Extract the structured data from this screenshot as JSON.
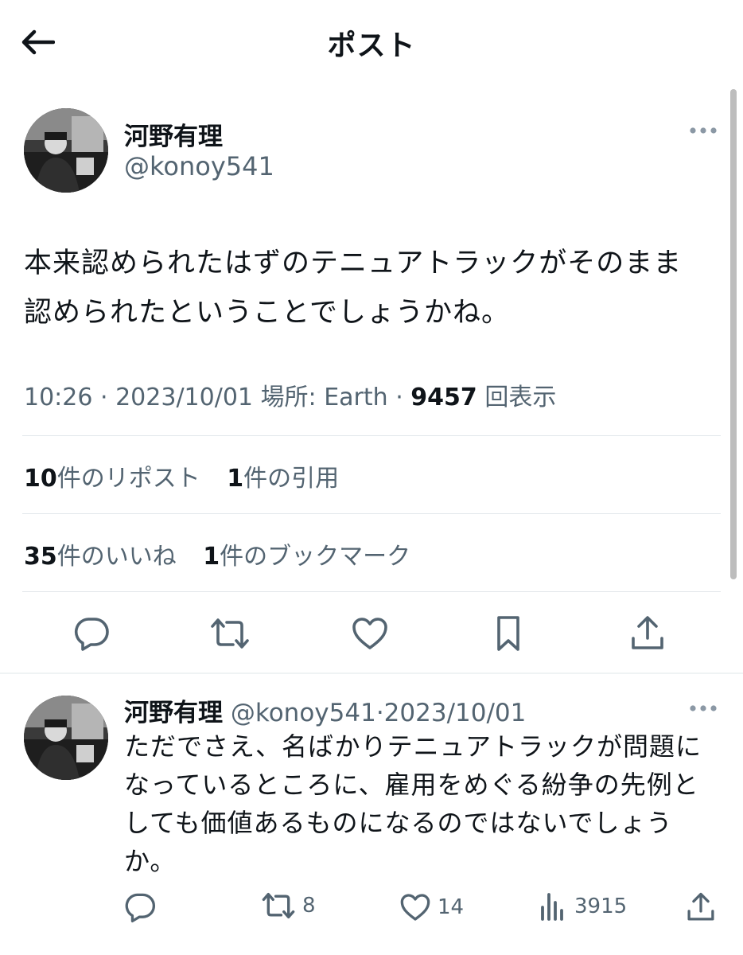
{
  "header": {
    "title": "ポスト"
  },
  "post": {
    "display_name": "河野有理",
    "handle": "@konoy541",
    "text_line1": "本来認められたはずのテニュアトラックがそのまま",
    "text_line2": "認められたということでしょうかね。",
    "time": "10:26",
    "date": "2023/10/01",
    "location": "場所: Earth",
    "views": "9457",
    "views_label": "回表示",
    "reposts_count": "10",
    "reposts_label": "件のリポスト",
    "quotes_count": "1",
    "quotes_label": "件の引用",
    "likes_count": "35",
    "likes_label": "件のいいね",
    "bookmarks_count": "1",
    "bookmarks_label": "件のブックマーク"
  },
  "reply": {
    "display_name": "河野有理",
    "handle": "@konoy541",
    "date": "2023/10/01",
    "text_line1": "ただでさえ、名ばかりテニュアトラックが問題に",
    "text_line2": "なっているところに、雇用をめぐる紛争の先例と",
    "text_line3": "しても価値あるものになるのではないでしょう",
    "text_line4": "か。",
    "retweets": "8",
    "likes": "14",
    "views": "3915"
  },
  "icons": {
    "back": "arrow-left-icon",
    "more": "more-horizontal-icon",
    "reply": "speech-bubble-icon",
    "retweet": "retweet-icon",
    "like": "heart-icon",
    "bookmark": "bookmark-icon",
    "share": "share-upload-icon",
    "views": "bar-chart-icon"
  },
  "colors": {
    "text": "#0f1419",
    "secondary": "#536471",
    "divider": "#e1e6ea"
  }
}
